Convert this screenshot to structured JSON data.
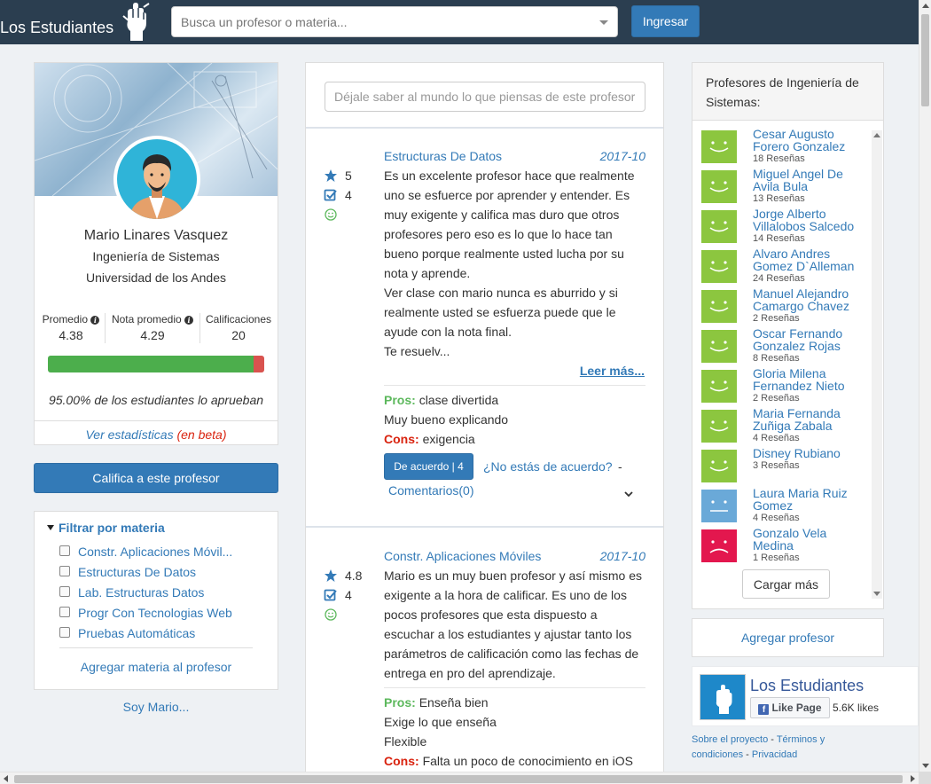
{
  "header": {
    "brand": "Los Estudiantes",
    "search_placeholder": "Busca un profesor o materia...",
    "login_label": "Ingresar"
  },
  "profile": {
    "name": "Mario Linares Vasquez",
    "department": "Ingeniería de Sistemas",
    "university": "Universidad de los Andes",
    "stats": [
      {
        "label": "Promedio",
        "value": "4.38"
      },
      {
        "label": "Nota promedio",
        "value": "4.29"
      },
      {
        "label": "Calificaciones",
        "value": "20"
      }
    ],
    "approval_fraction": 0.95,
    "approval_text": "95.00% de los estudiantes lo aprueban",
    "stats_link": "Ver estadísticas",
    "beta_label": "(en beta)"
  },
  "rate_button": "Califica a este profesor",
  "filter": {
    "title": "Filtrar por materia",
    "items": [
      "Constr. Aplicaciones Móvil...",
      "Estructuras De Datos",
      "Lab. Estructuras Datos",
      "Progr Con Tecnologias Web",
      "Pruebas Automáticas"
    ],
    "add_subject": "Agregar materia al profesor"
  },
  "soy_link": "Soy Mario...",
  "opinion_placeholder": "Déjale saber al mundo lo que piensas de este profesor",
  "reviews": [
    {
      "rating": "5",
      "grade": "4",
      "course": "Estructuras De Datos",
      "date": "2017-10",
      "text": [
        "Es un excelente profesor hace que realmente uno se esfuerce por aprender y entender. Es muy exigente y califica mas duro que otros profesores pero eso es lo que lo hace tan bueno porque realmente usted lucha por su nota y aprende.",
        "Ver clase con mario nunca es aburrido y si realmente usted se esfuerza puede que le ayude con la nota final.",
        "Te resuelv..."
      ],
      "read_more": "Leer más...",
      "pros_label": "Pros:",
      "pros": [
        "clase divertida",
        "Muy bueno explicando"
      ],
      "cons_label": "Cons:",
      "cons": [
        "exigencia"
      ],
      "agree_label": "De acuerdo | 4",
      "disagree_label": "¿No estás de acuerdo?",
      "separator": "-",
      "comments_label": "Comentarios(0)"
    },
    {
      "rating": "4.8",
      "grade": "4",
      "course": "Constr. Aplicaciones Móviles",
      "date": "2017-10",
      "text": [
        "Mario es un muy buen profesor y así mismo es exigente a la hora de calificar. Es uno de los pocos profesores que esta dispuesto a escuchar a los estudiantes y ajustar tanto los parámetros de calificación como las fechas de entrega en pro del aprendizaje."
      ],
      "pros_label": "Pros:",
      "pros": [
        "Enseña bien",
        "Exige lo que enseña",
        "Flexible"
      ],
      "cons_label": "Cons:",
      "cons": [
        "Falta un poco de conocimiento en iOS"
      ]
    }
  ],
  "professors_panel": {
    "title": "Profesores de Ingeniería de Sistemas:",
    "items": [
      {
        "name": "Cesar Augusto Forero Gonzalez",
        "count": "18 Reseñas",
        "mood": "happy",
        "color": "#8cc63f"
      },
      {
        "name": "Miguel Angel De Avila Bula",
        "count": "13 Reseñas",
        "mood": "happy",
        "color": "#8cc63f"
      },
      {
        "name": "Jorge Alberto Villalobos Salcedo",
        "count": "14 Reseñas",
        "mood": "happy",
        "color": "#8cc63f"
      },
      {
        "name": "Alvaro Andres Gomez D`Alleman",
        "count": "24 Reseñas",
        "mood": "happy",
        "color": "#8cc63f"
      },
      {
        "name": "Manuel Alejandro Camargo Chavez",
        "count": "2 Reseñas",
        "mood": "happy",
        "color": "#8cc63f"
      },
      {
        "name": "Oscar Fernando Gonzalez Rojas",
        "count": "8 Reseñas",
        "mood": "happy",
        "color": "#8cc63f"
      },
      {
        "name": "Gloria Milena Fernandez Nieto",
        "count": "2 Reseñas",
        "mood": "happy",
        "color": "#8cc63f"
      },
      {
        "name": "Maria Fernanda Zuñiga Zabala",
        "count": "4 Reseñas",
        "mood": "happy",
        "color": "#8cc63f"
      },
      {
        "name": "Disney Rubiano",
        "count": "3 Reseñas",
        "mood": "happy",
        "color": "#8cc63f"
      },
      {
        "name": "Laura Maria Ruiz Gomez",
        "count": "4 Reseñas",
        "mood": "neutral",
        "color": "#6aa9d8"
      },
      {
        "name": "Gonzalo Vela Medina",
        "count": "1 Reseñas",
        "mood": "sad",
        "color": "#e3174e"
      }
    ],
    "load_more": "Cargar más"
  },
  "add_professor": "Agregar profesor",
  "facebook": {
    "page_name": "Los Estudiantes",
    "like_label": "Like Page",
    "likes": "5.6K likes"
  },
  "footer": {
    "about": "Sobre el proyecto",
    "terms": "Términos y condiciones",
    "privacy": "Privacidad",
    "sep": "-"
  },
  "colors": {
    "navbar": "#2b3e50",
    "primary": "#337ab7",
    "success": "#4cae4c",
    "danger": "#d9534f"
  }
}
